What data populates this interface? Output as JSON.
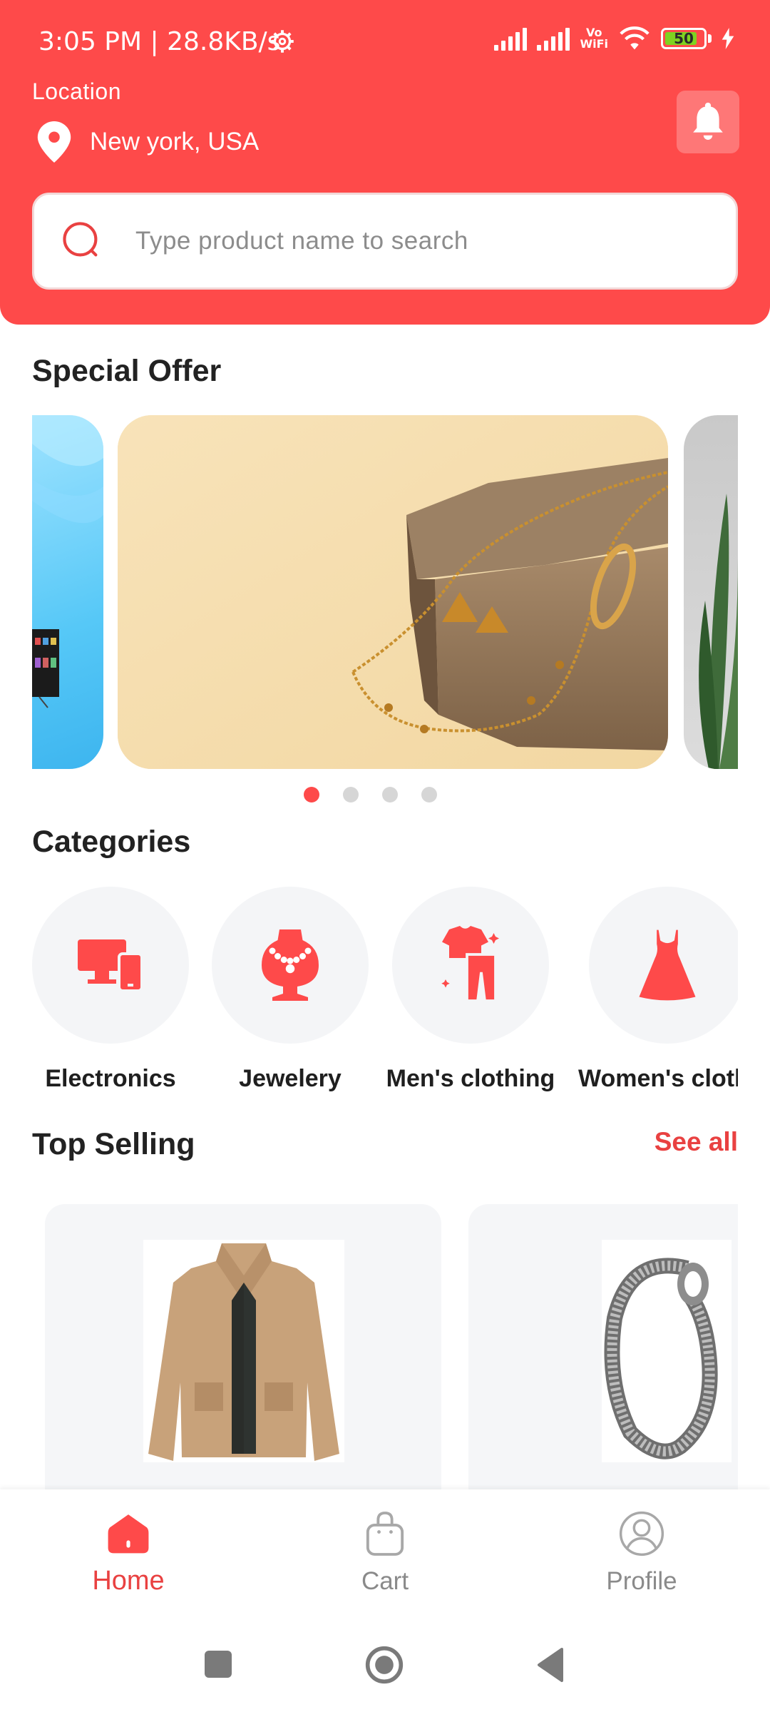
{
  "status_bar": {
    "time": "3:05 PM | 28.8KB/s",
    "battery": "50",
    "vowifi_top": "Vo",
    "vowifi_bottom": "WiFi"
  },
  "header": {
    "location_label": "Location",
    "location_value": "New york, USA",
    "bell_icon": "bell-icon"
  },
  "search": {
    "placeholder": "Type product name to search"
  },
  "special_offer": {
    "title": "Special Offer",
    "dots": 4,
    "active_dot": 0
  },
  "categories": {
    "title": "Categories",
    "items": [
      {
        "label": "Electronics",
        "icon": "devices-icon"
      },
      {
        "label": "Jewelery",
        "icon": "necklace-icon"
      },
      {
        "label": "Men's clothing",
        "icon": "mens-clothing-icon"
      },
      {
        "label": "Women's clothing",
        "icon": "dress-icon"
      }
    ]
  },
  "top_selling": {
    "title": "Top Selling",
    "see_all": "See all"
  },
  "bottom_nav": {
    "home": "Home",
    "cart": "Cart",
    "profile": "Profile"
  },
  "colors": {
    "primary": "#fe4a4a",
    "accent_text": "#e94141",
    "muted": "#8a8a8a"
  }
}
